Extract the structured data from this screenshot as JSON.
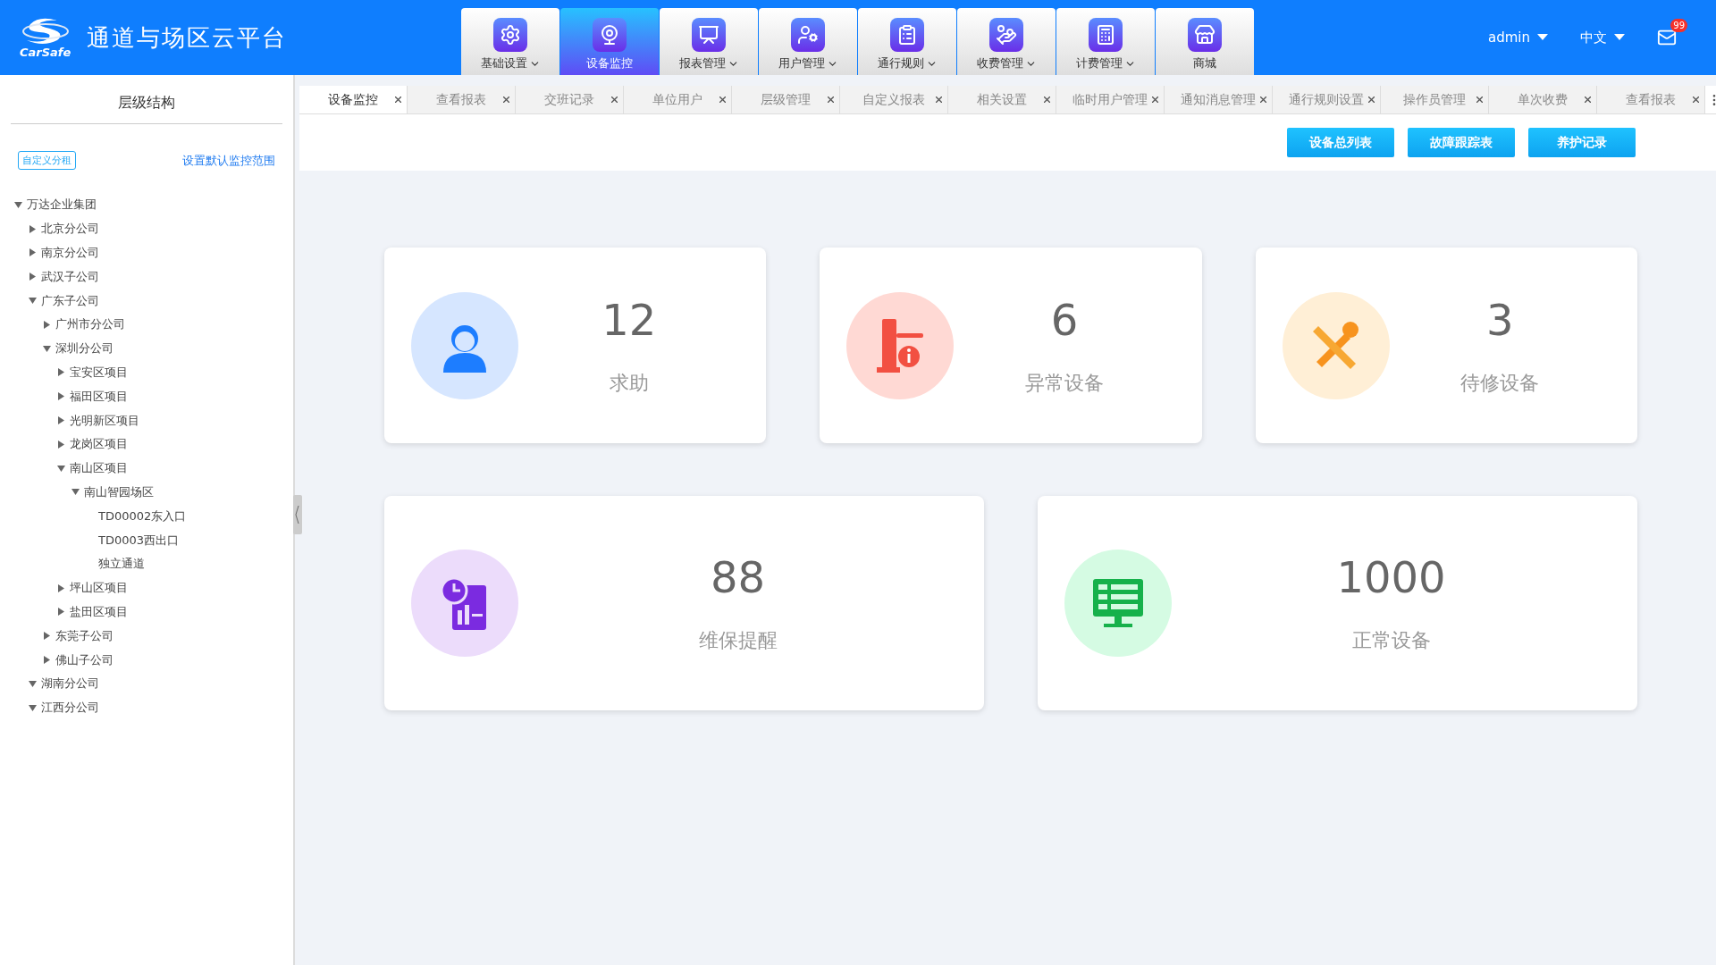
{
  "header": {
    "logo_text": "CarSafe",
    "title": "通道与场区云平台",
    "user": "admin",
    "language": "中文",
    "mail_badge": "99"
  },
  "nav": [
    {
      "label": "基础设置",
      "dropdown": true,
      "selected": false,
      "kind": "settings"
    },
    {
      "label": "设备监控",
      "dropdown": false,
      "selected": true,
      "kind": "camera"
    },
    {
      "label": "报表管理",
      "dropdown": true,
      "selected": false,
      "kind": "report"
    },
    {
      "label": "用户管理",
      "dropdown": true,
      "selected": false,
      "kind": "user"
    },
    {
      "label": "通行规则",
      "dropdown": true,
      "selected": false,
      "kind": "rule"
    },
    {
      "label": "收费管理",
      "dropdown": true,
      "selected": false,
      "kind": "fee"
    },
    {
      "label": "计费管理",
      "dropdown": true,
      "selected": false,
      "kind": "calc"
    },
    {
      "label": "商城",
      "dropdown": false,
      "selected": false,
      "kind": "shop"
    }
  ],
  "sidebar": {
    "title": "层级结构",
    "group_button": "自定义分租",
    "default_link": "设置默认监控范围",
    "tree": [
      {
        "label": "万达企业集团",
        "expanded": true,
        "children": [
          {
            "label": "北京分公司",
            "expanded": false
          },
          {
            "label": "南京分公司",
            "expanded": false
          },
          {
            "label": "武汉子公司",
            "expanded": false
          },
          {
            "label": "广东子公司",
            "expanded": true,
            "children": [
              {
                "label": "广州市分公司",
                "expanded": false
              },
              {
                "label": "深圳分公司",
                "expanded": true,
                "children": [
                  {
                    "label": "宝安区项目",
                    "expanded": false
                  },
                  {
                    "label": "福田区项目",
                    "expanded": false
                  },
                  {
                    "label": "光明新区项目",
                    "expanded": false
                  },
                  {
                    "label": "龙岗区项目",
                    "expanded": false
                  },
                  {
                    "label": "南山区项目",
                    "expanded": true,
                    "children": [
                      {
                        "label": "南山智园场区",
                        "expanded": true,
                        "children": [
                          {
                            "label": "TD00002东入口"
                          },
                          {
                            "label": "TD0003西出口"
                          },
                          {
                            "label": "独立通道"
                          }
                        ]
                      }
                    ]
                  },
                  {
                    "label": "坪山区项目",
                    "expanded": false
                  },
                  {
                    "label": "盐田区项目",
                    "expanded": false
                  }
                ]
              },
              {
                "label": "东莞子公司",
                "expanded": false
              },
              {
                "label": "佛山子公司",
                "expanded": false
              }
            ]
          },
          {
            "label": "湖南分公司",
            "expanded": true
          },
          {
            "label": "江西分公司",
            "expanded": true
          }
        ]
      }
    ]
  },
  "tabs": [
    {
      "label": "设备监控",
      "selected": true
    },
    {
      "label": "查看报表",
      "selected": false
    },
    {
      "label": "交班记录",
      "selected": false
    },
    {
      "label": "单位用户",
      "selected": false
    },
    {
      "label": "层级管理",
      "selected": false
    },
    {
      "label": "自定义报表",
      "selected": false
    },
    {
      "label": "相关设置",
      "selected": false
    },
    {
      "label": "临时用户管理",
      "selected": false
    },
    {
      "label": "通知消息管理",
      "selected": false
    },
    {
      "label": "通行规则设置",
      "selected": false
    },
    {
      "label": "操作员管理",
      "selected": false
    },
    {
      "label": "单次收费",
      "selected": false
    },
    {
      "label": "查看报表",
      "selected": false
    }
  ],
  "toolbar": [
    "设备总列表",
    "故障跟踪表",
    "养护记录"
  ],
  "cards": [
    [
      {
        "value": "12",
        "label": "求助",
        "kind": "help",
        "color": "#d6e6ff"
      },
      {
        "value": "6",
        "label": "异常设备",
        "kind": "fault",
        "color": "#ffd9d4"
      },
      {
        "value": "3",
        "label": "待修设备",
        "kind": "repair",
        "color": "#ffefd6"
      }
    ],
    [
      {
        "value": "88",
        "label": "维保提醒",
        "kind": "maintenance",
        "color": "#ecdcfb"
      },
      {
        "value": "1000",
        "label": "正常设备",
        "kind": "normal",
        "color": "#d5fbe3"
      }
    ]
  ]
}
